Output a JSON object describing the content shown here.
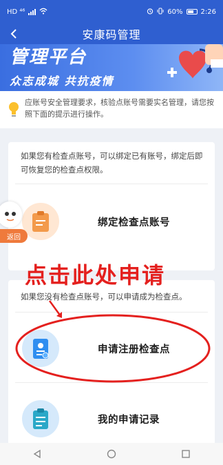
{
  "status_bar": {
    "left_indicators": "HD ⁴⁶",
    "battery": "60%",
    "time": "2:26"
  },
  "header": {
    "back_icon": "chevron-left-icon",
    "title": "安康码管理"
  },
  "banner": {
    "title": "管理平台",
    "subtitle": "众志成城 共抗疫情"
  },
  "notice": {
    "icon": "lightbulb-icon",
    "text": "应账号安全管理要求，核验点账号需要实名管理，请您按照下面的提示进行操作。"
  },
  "bind_card": {
    "description": "如果您有检查点账号，可以绑定已有账号，绑定后即可恢复您的检查点权限。",
    "action_label": "绑定检查点账号",
    "icon": "clipboard-icon"
  },
  "apply_card": {
    "description": "如果您没有检查点账号，可以申请成为检查点。",
    "register_label": "申请注册检查点",
    "register_icon": "id-badge-icon",
    "records_label": "我的申请记录",
    "records_icon": "checklist-icon"
  },
  "floating_assistant": {
    "return_label": "返回"
  },
  "annotation": {
    "text": "点击此处申请",
    "color": "#e4201e"
  },
  "nav_bar": {
    "back_icon": "triangle-back-icon",
    "home_icon": "circle-home-icon",
    "recent_icon": "square-recent-icon"
  },
  "colors": {
    "brand_blue": "#2f5fd0",
    "accent_orange": "#ef7a3c"
  }
}
